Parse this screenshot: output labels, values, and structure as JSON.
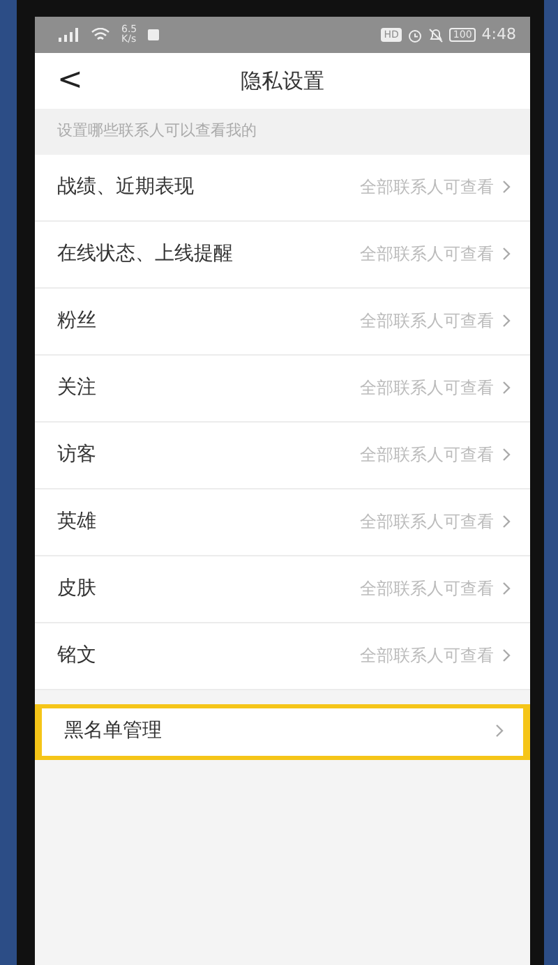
{
  "status_bar": {
    "speed_value": "6.5",
    "speed_unit": "K/s",
    "hd": "HD",
    "battery": "100",
    "time": "4:48"
  },
  "header": {
    "back": "<",
    "title": "隐私设置"
  },
  "section_label": "设置哪些联系人可以查看我的",
  "privacy_items": [
    {
      "label": "战绩、近期表现",
      "value": "全部联系人可查看"
    },
    {
      "label": "在线状态、上线提醒",
      "value": "全部联系人可查看"
    },
    {
      "label": "粉丝",
      "value": "全部联系人可查看"
    },
    {
      "label": "关注",
      "value": "全部联系人可查看"
    },
    {
      "label": "访客",
      "value": "全部联系人可查看"
    },
    {
      "label": "英雄",
      "value": "全部联系人可查看"
    },
    {
      "label": "皮肤",
      "value": "全部联系人可查看"
    },
    {
      "label": "铭文",
      "value": "全部联系人可查看"
    }
  ],
  "blacklist": {
    "label": "黑名单管理",
    "highlighted": true
  }
}
